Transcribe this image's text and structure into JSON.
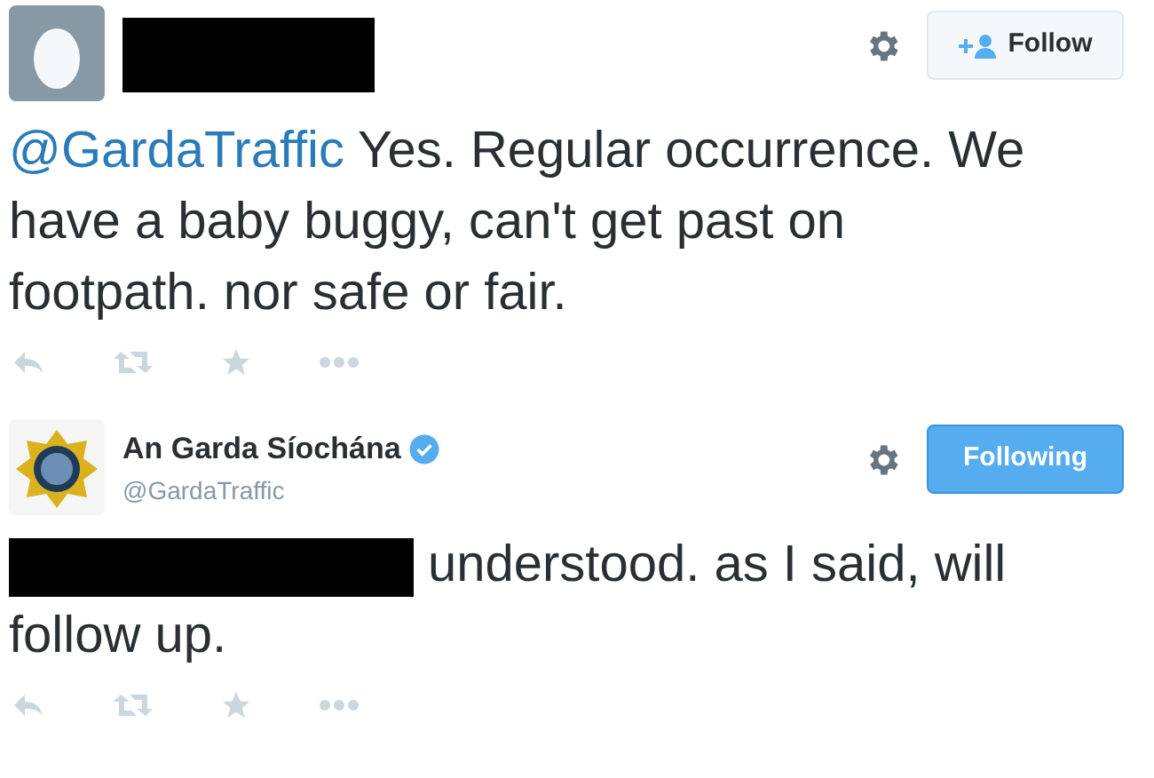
{
  "tweets": [
    {
      "avatar": {
        "kind": "egg"
      },
      "author": {
        "redacted": true
      },
      "follow_button": {
        "label": "Follow",
        "following": false
      },
      "mention": "@GardaTraffic",
      "body": "Yes. Regular occurrence. We have a baby buggy, can't get past on footpath. nor safe or fair.",
      "redacted_prefix": false
    },
    {
      "avatar": {
        "kind": "crest"
      },
      "author": {
        "redacted": false,
        "name": "An Garda Síochána",
        "handle": "@GardaTraffic",
        "verified": true
      },
      "follow_button": {
        "label": "Following",
        "following": true
      },
      "body": "understood. as I said, will follow up.",
      "redacted_prefix": true
    }
  ]
}
